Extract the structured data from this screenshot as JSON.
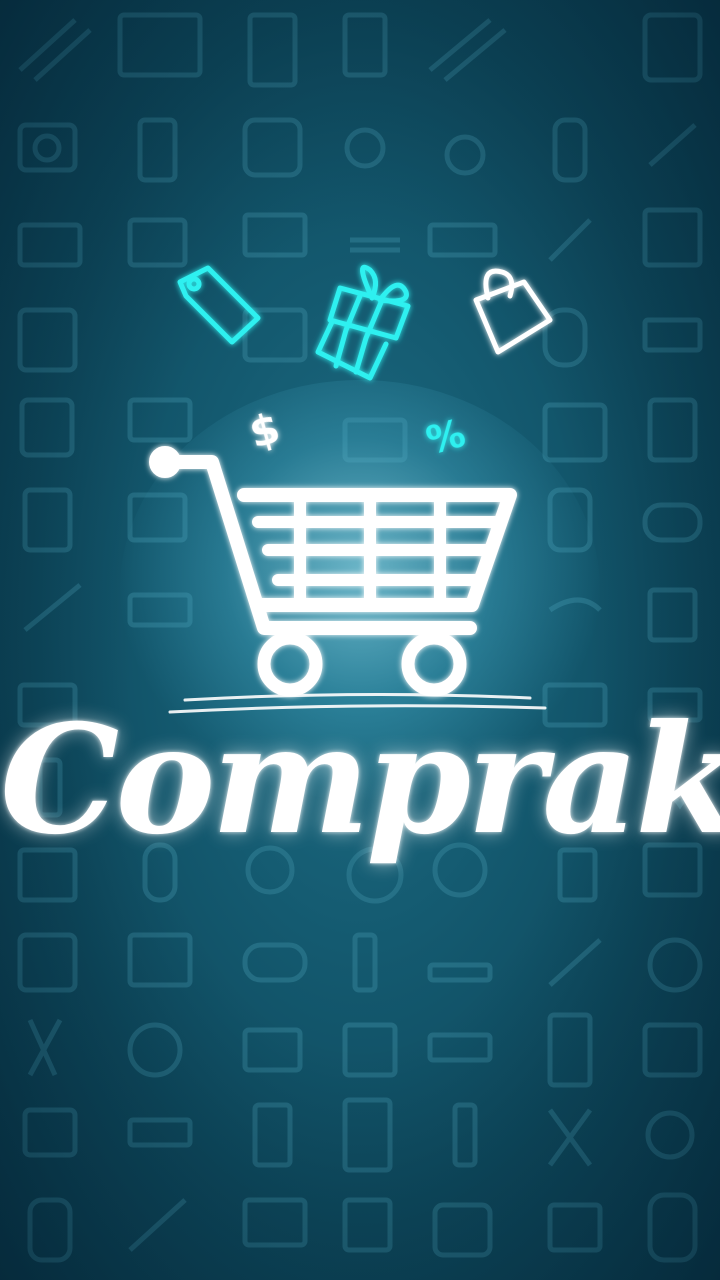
{
  "splash": {
    "brand_name": "Compraki",
    "dollar_symbol": "$",
    "percent_symbol": "%"
  },
  "colors": {
    "background": "#145a70",
    "neon_cyan": "#2ff0f0",
    "white": "#ffffff"
  },
  "icons": {
    "price_tag": "price-tag-icon",
    "gift": "gift-box-icon",
    "bag": "shopping-bag-icon",
    "cart": "shopping-cart-icon",
    "background_pattern": "electronics-pattern"
  }
}
